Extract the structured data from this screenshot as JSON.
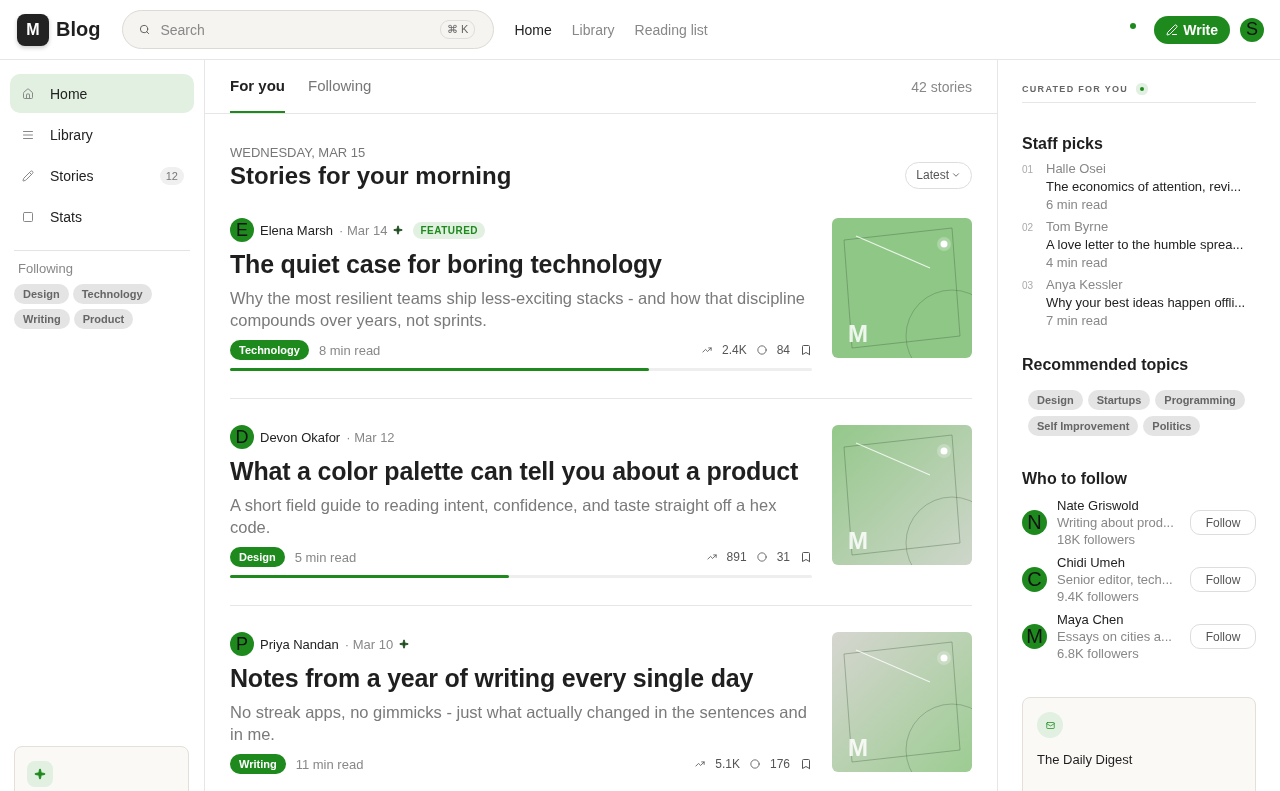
{
  "brand": {
    "logo": "M",
    "name": "Blog"
  },
  "search": {
    "placeholder": "Search",
    "shortcut": "⌘ K"
  },
  "top_nav": [
    {
      "label": "Home",
      "selected": true
    },
    {
      "label": "Library",
      "selected": false
    },
    {
      "label": "Reading list",
      "selected": false
    }
  ],
  "header_actions": {
    "write": "Write",
    "avatar": "S"
  },
  "sidebar": {
    "items": [
      {
        "label": "Home",
        "selected": true
      },
      {
        "label": "Library",
        "selected": false
      },
      {
        "label": "Stories",
        "selected": false,
        "count": "12"
      },
      {
        "label": "Stats",
        "selected": false
      }
    ],
    "following_title": "Following",
    "following_tags": [
      "Design",
      "Technology",
      "Writing",
      "Product"
    ]
  },
  "feed_tabs": [
    {
      "label": "For you",
      "selected": true
    },
    {
      "label": "Following",
      "selected": false
    }
  ],
  "story_count": "42 stories",
  "date_label": "WEDNESDAY, MAR 15",
  "heading": "Stories for your morning",
  "sort": "Latest",
  "stories": [
    {
      "avatar": "E",
      "author": "Elena Marsh",
      "date": "· Mar 14",
      "boosted": true,
      "badge": "FEATURED",
      "title": "The quiet case for boring technology",
      "deck": "Why the most resilient teams ship less-exciting stacks - and how that discipline compounds over years, not sprints.",
      "tag": "Technology",
      "read_time": "8 min read",
      "claps": "2.4K",
      "comments": "84",
      "level": 0.72,
      "thumb_label": "M"
    },
    {
      "avatar": "D",
      "author": "Devon Okafor",
      "date": "· Mar 12",
      "boosted": false,
      "title": "What a color palette can tell you about a product",
      "deck": "A short field guide to reading intent, confidence, and taste straight off a hex code.",
      "tag": "Design",
      "read_time": "5 min read",
      "claps": "891",
      "comments": "31",
      "level": 0.48,
      "thumb_label": "M"
    },
    {
      "avatar": "P",
      "author": "Priya Nandan",
      "date": "· Mar 10",
      "boosted": true,
      "title": "Notes from a year of writing every single day",
      "deck": "No streak apps, no gimmicks - just what actually changed in the sentences and in me.",
      "tag": "Writing",
      "read_time": "11 min read",
      "claps": "5.1K",
      "comments": "176",
      "thumb_label": "M"
    }
  ],
  "right": {
    "curated": "CURATED FOR YOU",
    "staff_title": "Staff picks",
    "staff_picks": [
      {
        "num": "01",
        "author": "Halle Osei",
        "title": "The economics of attention, revi...",
        "read_time": "6 min read"
      },
      {
        "num": "02",
        "author": "Tom Byrne",
        "title": "A love letter to the humble sprea...",
        "read_time": "4 min read"
      },
      {
        "num": "03",
        "author": "Anya Kessler",
        "title": "Why your best ideas happen offli...",
        "read_time": "7 min read"
      }
    ],
    "topics_title": "Recommended topics",
    "topics": [
      "Design",
      "Startups",
      "Programming",
      "Self Improvement",
      "Politics"
    ],
    "follow_title": "Who to follow",
    "people": [
      {
        "avatar": "N",
        "name": "Nate Griswold",
        "bio": "Writing about prod...",
        "followers": "18K followers",
        "button": "Follow"
      },
      {
        "avatar": "C",
        "name": "Chidi Umeh",
        "bio": "Senior editor, tech...",
        "followers": "9.4K followers",
        "button": "Follow"
      },
      {
        "avatar": "M",
        "name": "Maya Chen",
        "bio": "Essays on cities a...",
        "followers": "6.8K followers",
        "button": "Follow"
      }
    ],
    "digest_title": "The Daily Digest"
  }
}
